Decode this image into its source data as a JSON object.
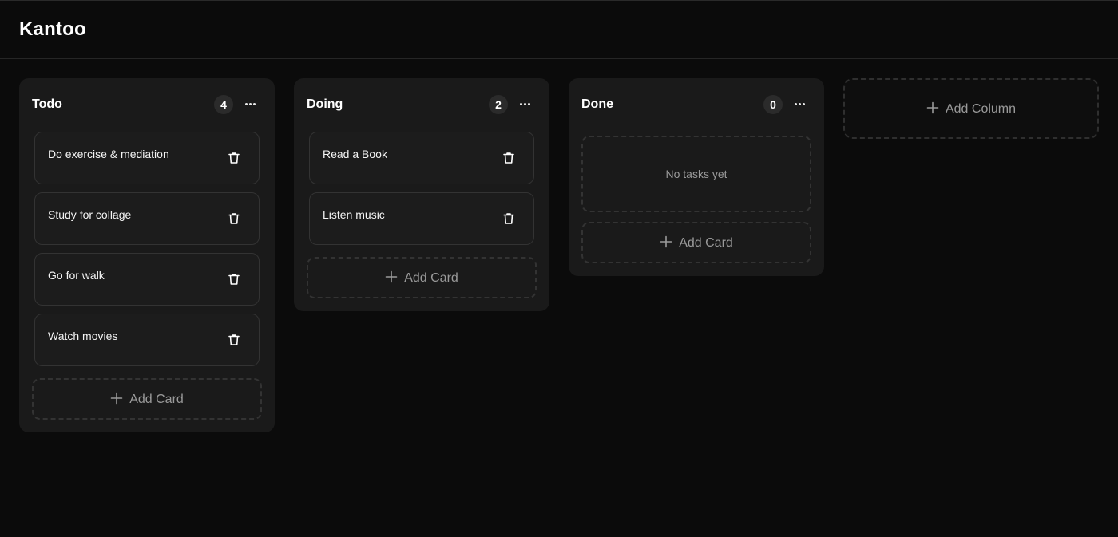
{
  "app": {
    "title": "Kantoo"
  },
  "columns": [
    {
      "title": "Todo",
      "count": "4",
      "cards": [
        {
          "text": "Do exercise & mediation"
        },
        {
          "text": "Study for collage"
        },
        {
          "text": "Go for walk"
        },
        {
          "text": "Watch movies"
        }
      ],
      "add_card_label": "Add Card"
    },
    {
      "title": "Doing",
      "count": "2",
      "cards": [
        {
          "text": "Read a Book"
        },
        {
          "text": "Listen music"
        }
      ],
      "add_card_label": "Add Card"
    },
    {
      "title": "Done",
      "count": "0",
      "cards": [],
      "empty_text": "No tasks yet",
      "add_card_label": "Add Card"
    }
  ],
  "add_column_label": "Add Column",
  "icons": {
    "more": "more-horizontal-icon",
    "delete": "trash-icon",
    "add": "plus-icon"
  },
  "colors": {
    "background": "#0b0b0b",
    "column": "#1a1a1a",
    "card": "#1c1c1c",
    "border": "#333333",
    "muted_text": "#9a9a9a"
  }
}
